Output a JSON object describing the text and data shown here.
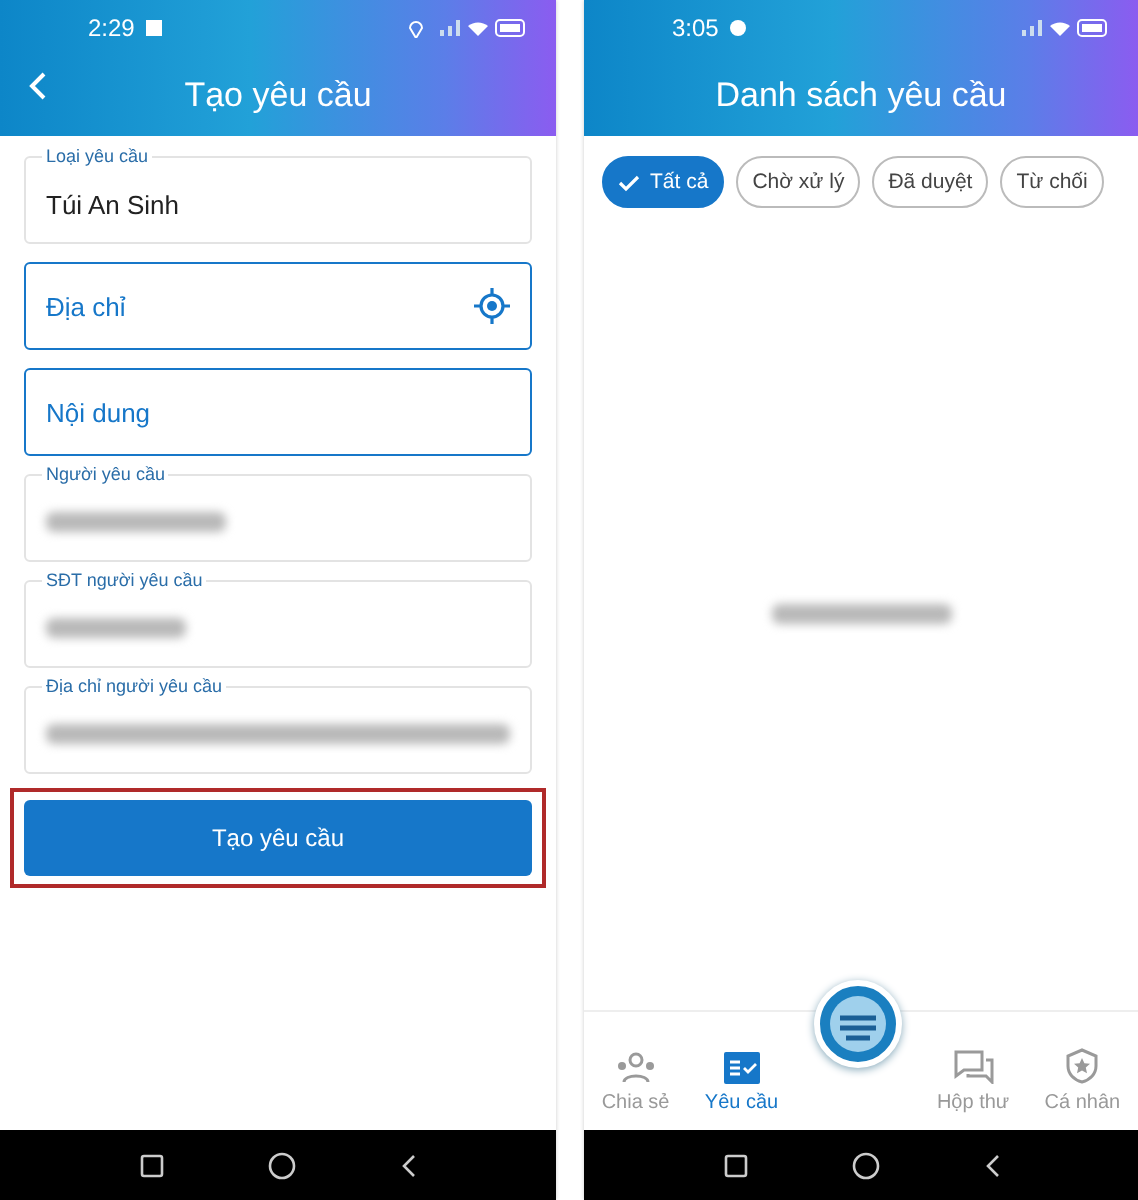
{
  "create_screen": {
    "status_bar": {
      "time": "2:29"
    },
    "title": "Tạo yêu cầu",
    "fields": [
      {
        "kind": "filled",
        "label": "Loại yêu cầu",
        "value": "Túi An Sinh"
      },
      {
        "kind": "empty",
        "placeholder": "Địa chỉ",
        "has_location_icon": true
      },
      {
        "kind": "empty",
        "placeholder": "Nội dung",
        "has_location_icon": false
      },
      {
        "kind": "blurred",
        "label": "Người yêu cầu"
      },
      {
        "kind": "blurred",
        "label": "SĐT người yêu cầu"
      },
      {
        "kind": "blurred",
        "label": "Địa chỉ người yêu cầu"
      }
    ],
    "submit_button": {
      "label": "Tạo yêu cầu",
      "highlighted": true
    }
  },
  "list_screen": {
    "status_bar": {
      "time": "3:05"
    },
    "title": "Danh sách yêu cầu",
    "filters": [
      {
        "label": "Tất cả",
        "selected": true
      },
      {
        "label": "Chờ xử lý",
        "selected": false
      },
      {
        "label": "Đã duyệt",
        "selected": false
      },
      {
        "label": "Từ chối",
        "selected": false
      }
    ],
    "bottom_nav": [
      {
        "kind": "people",
        "label": "Chia sẻ",
        "selected": false
      },
      {
        "kind": "list",
        "label": "Yêu cầu",
        "selected": true
      },
      {
        "kind": "fab"
      },
      {
        "kind": "chat",
        "label": "Hộp thư",
        "selected": false
      },
      {
        "kind": "shield",
        "label": "Cá nhân",
        "selected": false
      }
    ]
  }
}
